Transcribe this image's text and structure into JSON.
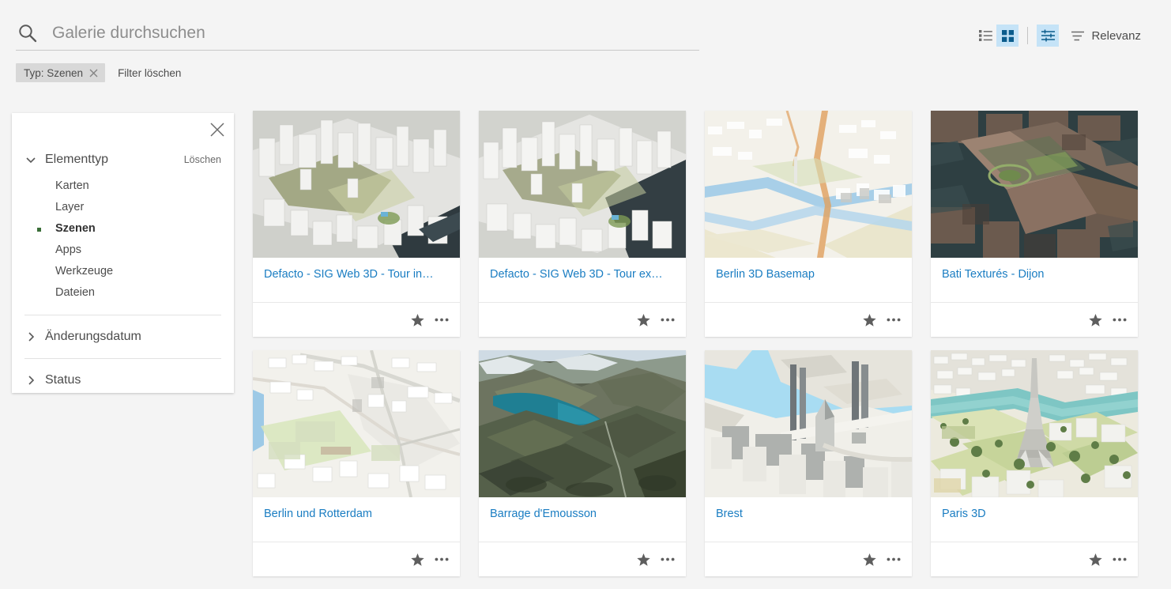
{
  "search": {
    "placeholder": "Galerie durchsuchen",
    "value": "",
    "icon": "search-icon"
  },
  "filters_bar": {
    "chip_label": "Typ: Szenen",
    "chip_remove_icon": "close-icon",
    "clear_label": "Filter löschen"
  },
  "view_tools": {
    "list_view_icon": "list-view-icon",
    "grid_view_icon": "grid-view-icon",
    "filter_icon": "filter-sliders-icon",
    "sort_icon": "sort-icon",
    "sort_label": "Relevanz",
    "active_grid": true,
    "active_filter": true,
    "accent_active_bg": "#c5e3f7",
    "accent_icon": "#0b5c8c"
  },
  "filter_panel": {
    "close_icon": "close-icon",
    "groups": [
      {
        "title": "Elementtyp",
        "expanded": true,
        "clear_label": "Löschen",
        "items": [
          {
            "label": "Karten",
            "selected": false
          },
          {
            "label": "Layer",
            "selected": false
          },
          {
            "label": "Szenen",
            "selected": true
          },
          {
            "label": "Apps",
            "selected": false
          },
          {
            "label": "Werkzeuge",
            "selected": false
          },
          {
            "label": "Dateien",
            "selected": false
          }
        ]
      },
      {
        "title": "Änderungsdatum",
        "expanded": false
      },
      {
        "title": "Status",
        "expanded": false
      }
    ],
    "selected_dot_color": "#3a6e38"
  },
  "gallery": {
    "link_color": "#1a7dc2",
    "favorite_icon": "star-icon",
    "more_icon": "more-options-icon",
    "cards": [
      {
        "title": "Defacto - SIG Web 3D - Tour in…",
        "thumb": "city-white-3d"
      },
      {
        "title": "Defacto - SIG Web 3D - Tour ex…",
        "thumb": "city-white-3d-2"
      },
      {
        "title": "Berlin 3D Basemap",
        "thumb": "berlin-basemap"
      },
      {
        "title": "Bati Texturés - Dijon",
        "thumb": "dijon-textured"
      },
      {
        "title": "Berlin und Rotterdam",
        "thumb": "berlin-rotterdam-basemap"
      },
      {
        "title": "Barrage d'Emousson",
        "thumb": "mountain-lake"
      },
      {
        "title": "Brest",
        "thumb": "brest-harbor"
      },
      {
        "title": "Paris 3D",
        "thumb": "paris-eiffel"
      }
    ]
  }
}
